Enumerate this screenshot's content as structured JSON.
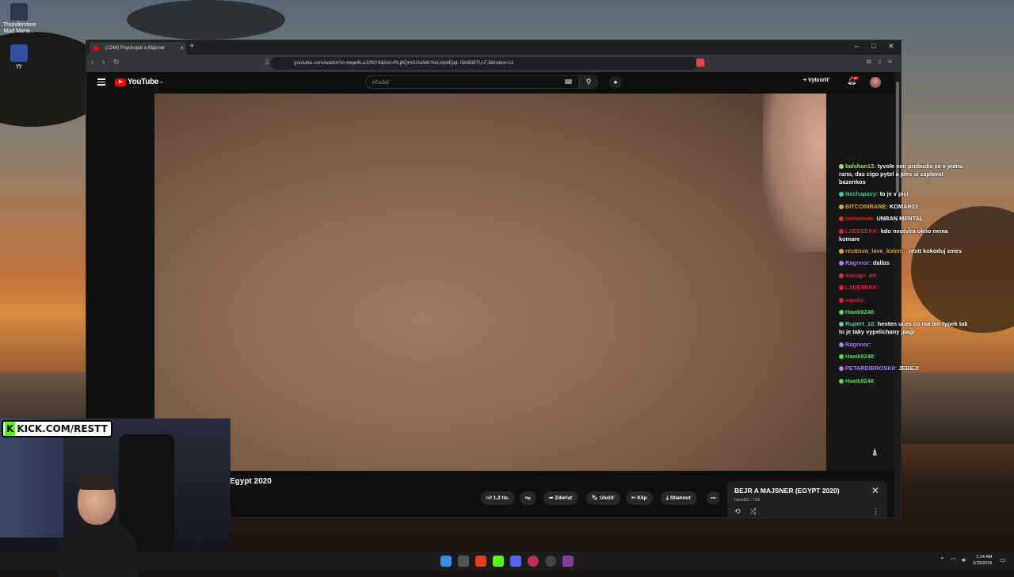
{
  "desktop": {
    "icons": [
      {
        "label": "Thunderstore Mod Mana..."
      },
      {
        "label": "yy"
      }
    ]
  },
  "browser": {
    "tab_title": "(1248) Psychopat a Majsner",
    "url": "youtube.com/watch?v=mqe4LeJ2NY4&list=PLj8QmSUwWLYicUAptEjqL l5lnBi87U-FJ&index=11"
  },
  "youtube": {
    "logo_text": "YouTube",
    "region": "SK",
    "search_placeholder": "Hľadať",
    "create_label": "Vytvoriť",
    "notif_count": "9+",
    "video_title": "Egypt 2020",
    "actions": {
      "like": "1,3 tis.",
      "share": "Zdieľať",
      "save": "Uložiť",
      "clip": "Klip",
      "download": "Stiahnuť"
    },
    "playlist": {
      "title": "BEJR A MAJSNER (EGYPT 2020)",
      "subtitle": "David35 - 7/26"
    }
  },
  "stream": {
    "kick_text": "KICK.COM/RESTT",
    "chat": [
      {
        "user": "balshan13:",
        "color": "#a0e060",
        "text": "tyvole sen probudis se v jednu rano, das cigo pytel a jdes si zaplavat bazenkos"
      },
      {
        "user": "Nechapavy:",
        "color": "#40d0a0",
        "text": "to je v pici"
      },
      {
        "user": "BITCOINRARE:",
        "color": "#f0a030",
        "text": "KOMAR22"
      },
      {
        "user": "lantanium:",
        "color": "#e03030",
        "text": "UNBAN MENTAL"
      },
      {
        "user": "LXDEEEKK:",
        "color": "#e02040",
        "text": "kdo neotvira okno nema komare"
      },
      {
        "user": "resttovo_lave_koleno:",
        "color": "#f0a030",
        "text": "restt kokoduj zmes"
      },
      {
        "user": "Ragnnor:",
        "color": "#b080ff",
        "text": "dallas"
      },
      {
        "user": "Savage_69:",
        "color": "#e03030",
        "text": ""
      },
      {
        "user": "LXDEEEKK:",
        "color": "#e02040",
        "text": ""
      },
      {
        "user": "sandiz:",
        "color": "#e02040",
        "text": ""
      },
      {
        "user": "Hawk9248:",
        "color": "#50e050",
        "text": ""
      },
      {
        "user": "Rupert_10:",
        "color": "#60d0b0",
        "text": "henten uces co ma ten typek tak to je taky vypelichany jaagr"
      },
      {
        "user": "Ragnnor:",
        "color": "#b080ff",
        "text": ""
      },
      {
        "user": "Hawk9248:",
        "color": "#50e050",
        "text": ""
      },
      {
        "user": "PETARDIBROSKII:",
        "color": "#b080ff",
        "text": "JEBEJ!"
      },
      {
        "user": "Hawk9248:",
        "color": "#50e050",
        "text": ""
      }
    ]
  },
  "taskbar": {
    "time": "1:14 AM",
    "date": "3/29/2026"
  }
}
